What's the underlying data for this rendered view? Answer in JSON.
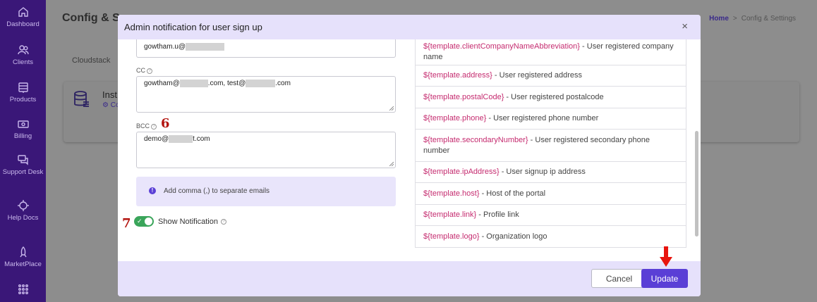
{
  "sidebar": {
    "items": [
      {
        "label": "Dashboard",
        "icon": "home-icon"
      },
      {
        "label": "Clients",
        "icon": "users-icon"
      },
      {
        "label": "Products",
        "icon": "server-icon"
      },
      {
        "label": "Billing",
        "icon": "money-icon"
      },
      {
        "label": "Support Desk",
        "icon": "chat-icon"
      },
      {
        "label": "Help Docs",
        "icon": "help-icon"
      },
      {
        "label": "MarketPlace",
        "icon": "rocket-icon"
      },
      {
        "label": "",
        "icon": "apps-icon"
      }
    ]
  },
  "page": {
    "title": "Config & Se",
    "breadcrumb": {
      "home": "Home",
      "separator": ">",
      "current": "Config & Settings"
    },
    "tab": "Cloudstack",
    "card_title": "Inst",
    "card_sub": "⚙ Co"
  },
  "modal": {
    "title": "Admin notification for user sign up",
    "close_label": "×",
    "to_value_prefix": "gowtham.u@",
    "cc_label": "CC",
    "cc_value": {
      "a": "gowtham@",
      "b": ".com, test@",
      "c": ".com"
    },
    "bcc_label": "BCC",
    "bcc_value": {
      "a": "demo@",
      "b": "t.com"
    },
    "info_text": "Add comma (,) to separate emails",
    "toggle_label": "Show Notification",
    "step_6": "6",
    "step_7": "7",
    "cancel_label": "Cancel",
    "update_label": "Update",
    "variables": [
      {
        "key": "${template.clientCompanyNameAbbreviation}",
        "desc": " - User registered company name",
        "height": 37
      },
      {
        "key": "${template.address}",
        "desc": " - User registered address",
        "height": 30
      },
      {
        "key": "${template.postalCode}",
        "desc": " - User registered postalcode",
        "height": 31
      },
      {
        "key": "${template.phone}",
        "desc": " - User registered phone number",
        "height": 30
      },
      {
        "key": "${template.secondaryNumber}",
        "desc": " - User registered secondary phone number",
        "height": 46
      },
      {
        "key": "${template.ipAddress}",
        "desc": " - User signup ip address",
        "height": 30
      },
      {
        "key": "${template.host}",
        "desc": " - Host of the portal",
        "height": 31
      },
      {
        "key": "${template.link}",
        "desc": " - Profile link",
        "height": 30
      },
      {
        "key": "${template.logo}",
        "desc": " - Organization logo",
        "height": 31
      }
    ]
  },
  "colors": {
    "sidebar": "#3a1778",
    "accent": "#5a3fd6",
    "modal_header": "#e6e1fb",
    "variable_key": "#c52b6f",
    "annotation": "#b3140f",
    "toggle_on": "#3aa55a"
  }
}
